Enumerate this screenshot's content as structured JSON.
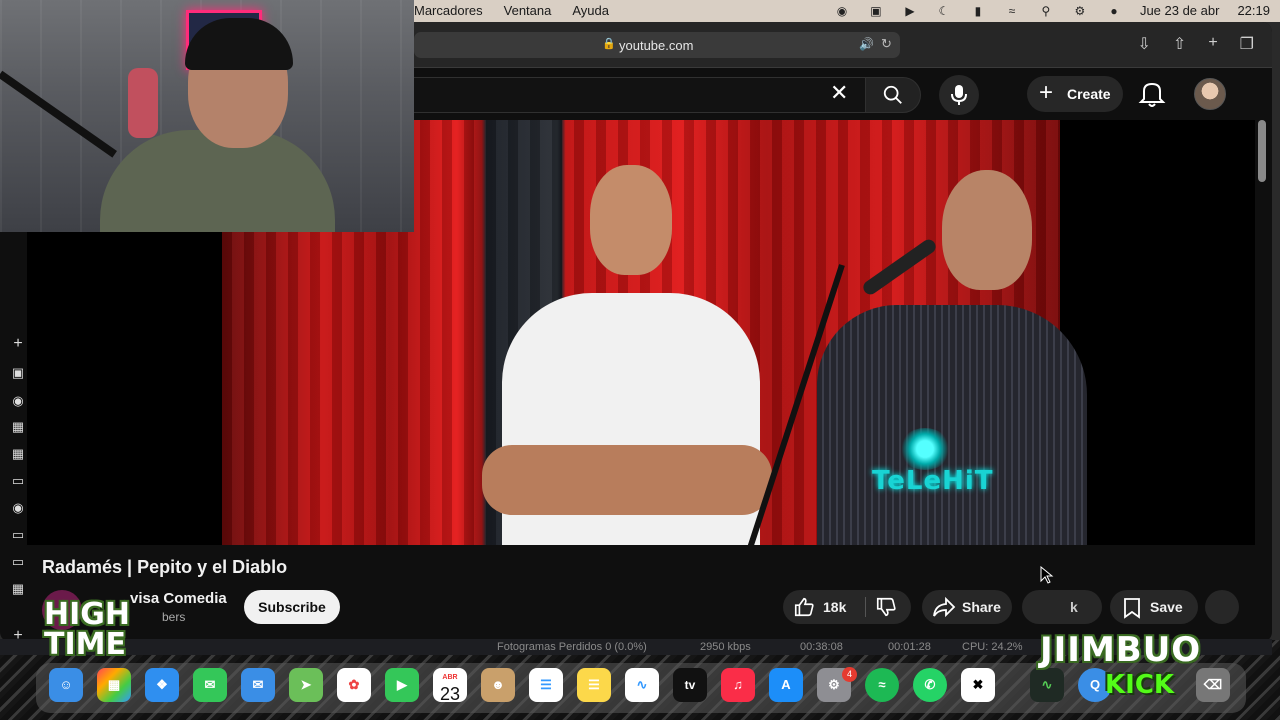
{
  "menubar": {
    "menus": [
      "Marcadores",
      "Ventana",
      "Ayuda"
    ],
    "date": "Jue 23 de abr",
    "time": "22:19"
  },
  "safari": {
    "url": "youtube.com",
    "icons": [
      "lock-icon",
      "audio-icon",
      "reload-icon",
      "download-icon",
      "share-icon",
      "new-tab-icon",
      "tabs-overview-icon"
    ]
  },
  "youtube": {
    "create_label": "Create",
    "video": {
      "title": "Radamés | Pepito y el Diablo",
      "channel": "Televisa Comedia",
      "channel_visible": "visa Comedia",
      "subscribers_visible": "bers",
      "subscribe_label": "Subscribe",
      "likes": "18k",
      "share_label": "Share",
      "clip_visible": "k",
      "save_label": "Save",
      "watermark": "TeLeHiT"
    }
  },
  "obs_stats": {
    "dropped_frames": "Fotogramas Perdidos 0 (0.0%)",
    "bitrate": "2950 kbps",
    "stream_time": "00:38:08",
    "rec_time": "00:01:28",
    "cpu": "CPU: 24.2%"
  },
  "dock": {
    "calendar_month": "ABR",
    "calendar_day": "23",
    "settings_badge": "4",
    "tv_label": "tv"
  },
  "overlays": {
    "hightime_line1": "HIGH",
    "hightime_line2": "TIME",
    "brand": "JIIMBUO",
    "kick": "KICK"
  },
  "colors": {
    "youtube_bg": "#0f0f0f",
    "menubar_bg": "#d9cfc4",
    "kick_green": "#53fc18"
  }
}
